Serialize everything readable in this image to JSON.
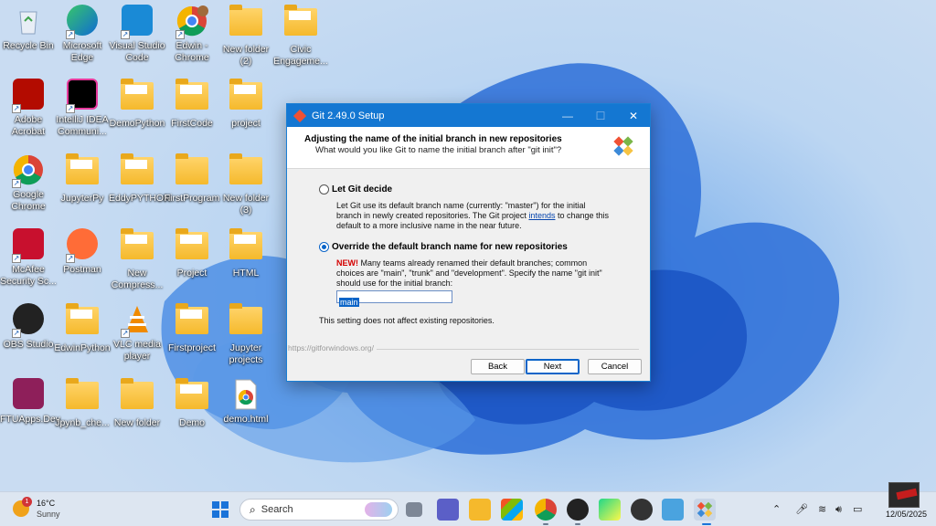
{
  "desktop": {
    "icons": [
      {
        "label": "Recycle Bin"
      },
      {
        "label": "Microsoft Edge"
      },
      {
        "label": "Visual Studio Code"
      },
      {
        "label": "Edwin - Chrome"
      },
      {
        "label": "New folder (2)"
      },
      {
        "label": "Civic Engageme..."
      },
      {
        "label": "Adobe Acrobat"
      },
      {
        "label": "IntelliJ IDEA Communi..."
      },
      {
        "label": "DemoPython"
      },
      {
        "label": "FirstCode"
      },
      {
        "label": "project"
      },
      {
        "label": "Google Chrome"
      },
      {
        "label": "JupyterPy"
      },
      {
        "label": "EddyPYTHON"
      },
      {
        "label": "FirstProgram"
      },
      {
        "label": "New folder (3)"
      },
      {
        "label": "McAfee Security Sc..."
      },
      {
        "label": "Postman"
      },
      {
        "label": "New Compress..."
      },
      {
        "label": "Project"
      },
      {
        "label": "HTML"
      },
      {
        "label": "OBS Studio"
      },
      {
        "label": "EdwinPython"
      },
      {
        "label": "VLC media player"
      },
      {
        "label": "Firstproject"
      },
      {
        "label": "Jupyter projects"
      },
      {
        "label": "FTUApps.Dev"
      },
      {
        "label": "Jpynb_che..."
      },
      {
        "label": "New folder"
      },
      {
        "label": "Demo"
      },
      {
        "label": "demo.html"
      }
    ]
  },
  "dialog": {
    "title": "Git 2.49.0 Setup",
    "header_title": "Adjusting the name of the initial branch in new repositories",
    "header_subtitle": "What would you like Git to name the initial branch after \"git init\"?",
    "option1": {
      "label": "Let Git decide",
      "desc_before_link": "Let Git use its default branch name (currently: \"master\") for the initial branch in newly created repositories. The Git project ",
      "link": "intends",
      "desc_after_link": " to change this default to a more inclusive name in the near future.",
      "selected": false
    },
    "option2": {
      "label": "Override the default branch name for new repositories",
      "new_tag": "NEW!",
      "desc": " Many teams already renamed their default branches; common choices are \"main\", \"trunk\" and \"development\". Specify the name \"git init\" should use for the initial branch:",
      "selected": true
    },
    "branch_value": "main",
    "note": "This setting does not affect existing repositories.",
    "url": "https://gitforwindows.org/",
    "buttons": {
      "back": "Back",
      "next": "Next",
      "cancel": "Cancel"
    }
  },
  "taskbar": {
    "weather_temp": "16°C",
    "weather_desc": "Sunny",
    "weather_badge": "1",
    "search_placeholder": "Search",
    "clock_date": "12/05/2025"
  },
  "colors": {
    "accent": "#1477d2",
    "taskbar": "#dde6f1"
  }
}
